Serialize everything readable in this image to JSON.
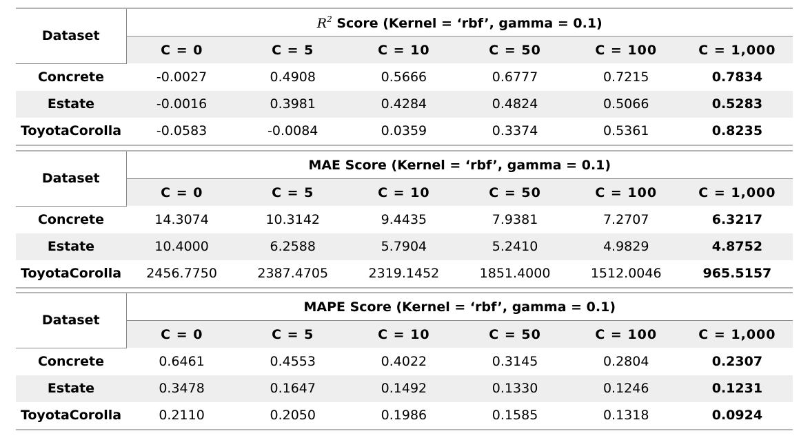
{
  "tables": [
    {
      "dataset_header": "Dataset",
      "title_prefix": "R",
      "title_sup": "2",
      "title_text": " Score (Kernel = ‘rbf’, gamma = 0.1)",
      "columns": [
        "C = 0",
        "C = 5",
        "C = 10",
        "C = 50",
        "C = 100",
        "C = 1,000"
      ],
      "rows": [
        {
          "dataset": "Concrete",
          "values": [
            "-0.0027",
            "0.4908",
            "0.5666",
            "0.6777",
            "0.7215",
            "0.7834"
          ]
        },
        {
          "dataset": "Estate",
          "values": [
            "-0.0016",
            "0.3981",
            "0.4284",
            "0.4824",
            "0.5066",
            "0.5283"
          ]
        },
        {
          "dataset": "ToyotaCorolla",
          "values": [
            "-0.0583",
            "-0.0084",
            "0.0359",
            "0.3374",
            "0.5361",
            "0.8235"
          ]
        }
      ]
    },
    {
      "dataset_header": "Dataset",
      "title_text": "MAE Score (Kernel = ‘rbf’, gamma = 0.1)",
      "columns": [
        "C = 0",
        "C = 5",
        "C = 10",
        "C = 50",
        "C = 100",
        "C = 1,000"
      ],
      "rows": [
        {
          "dataset": "Concrete",
          "values": [
            "14.3074",
            "10.3142",
            "9.4435",
            "7.9381",
            "7.2707",
            "6.3217"
          ]
        },
        {
          "dataset": "Estate",
          "values": [
            "10.4000",
            "6.2588",
            "5.7904",
            "5.2410",
            "4.9829",
            "4.8752"
          ]
        },
        {
          "dataset": "ToyotaCorolla",
          "values": [
            "2456.7750",
            "2387.4705",
            "2319.1452",
            "1851.4000",
            "1512.0046",
            "965.5157"
          ]
        }
      ]
    },
    {
      "dataset_header": "Dataset",
      "title_text": "MAPE Score (Kernel = ‘rbf’, gamma = 0.1)",
      "columns": [
        "C = 0",
        "C = 5",
        "C = 10",
        "C = 50",
        "C = 100",
        "C = 1,000"
      ],
      "rows": [
        {
          "dataset": "Concrete",
          "values": [
            "0.6461",
            "0.4553",
            "0.4022",
            "0.3145",
            "0.2804",
            "0.2307"
          ]
        },
        {
          "dataset": "Estate",
          "values": [
            "0.3478",
            "0.1647",
            "0.1492",
            "0.1330",
            "0.1246",
            "0.1231"
          ]
        },
        {
          "dataset": "ToyotaCorolla",
          "values": [
            "0.2110",
            "0.2050",
            "0.1986",
            "0.1585",
            "0.1318",
            "0.0924"
          ]
        }
      ]
    }
  ]
}
